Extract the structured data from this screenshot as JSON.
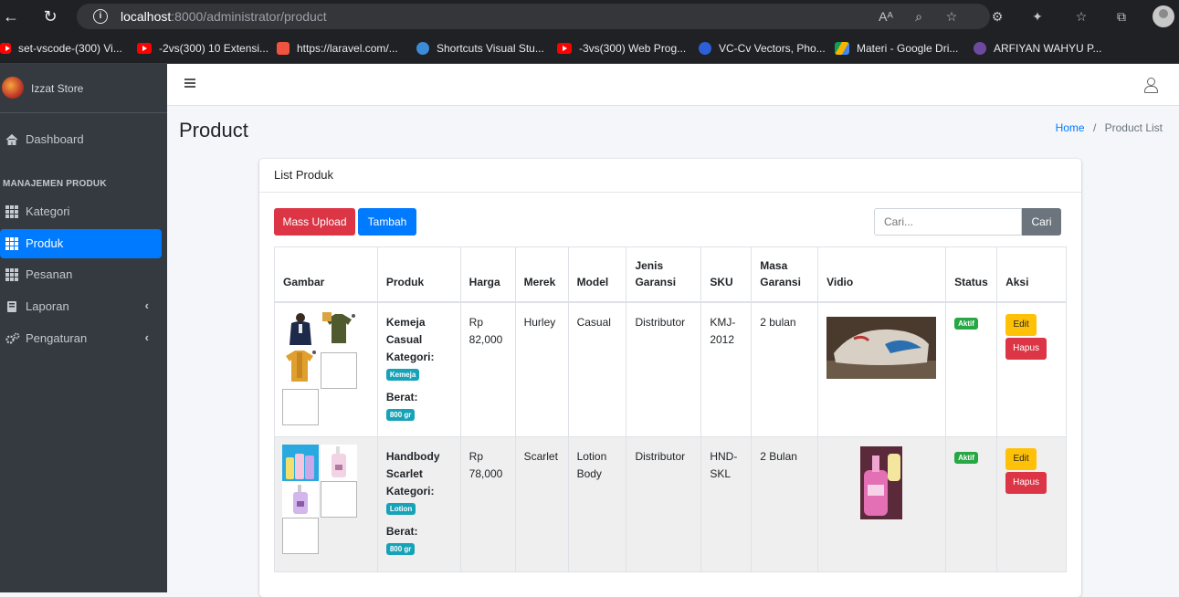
{
  "browser": {
    "url_host": "localhost",
    "url_rest": ":8000/administrator/product",
    "bookmarks": [
      {
        "label": "set-vscode-(300) Vi..."
      },
      {
        "label": "-2vs(300) 10 Extensi..."
      },
      {
        "label": "https://laravel.com/..."
      },
      {
        "label": "Shortcuts Visual Stu..."
      },
      {
        "label": "-3vs(300) Web Prog..."
      },
      {
        "label": "VC-Cv Vectors, Pho..."
      },
      {
        "label": "Materi - Google Dri..."
      },
      {
        "label": "ARFIYAN WAHYU P..."
      }
    ]
  },
  "sidebar": {
    "brand": "Izzat Store",
    "dashboard": "Dashboard",
    "header": "MANAJEMEN PRODUK",
    "items": [
      {
        "label": "Kategori"
      },
      {
        "label": "Produk"
      },
      {
        "label": "Pesanan"
      },
      {
        "label": "Laporan"
      },
      {
        "label": "Pengaturan"
      }
    ]
  },
  "page": {
    "title": "Product",
    "breadcrumb_home": "Home",
    "breadcrumb_current": "Product List"
  },
  "card": {
    "title": "List Produk",
    "mass_upload": "Mass Upload",
    "tambah": "Tambah",
    "search_placeholder": "Cari...",
    "search_button": "Cari"
  },
  "table": {
    "headers": [
      "Gambar",
      "Produk",
      "Harga",
      "Merek",
      "Model",
      "Jenis Garansi",
      "SKU",
      "Masa Garansi",
      "Vidio",
      "Status",
      "Aksi"
    ],
    "category_label": "Kategori:",
    "weight_label": "Berat:",
    "edit_label": "Edit",
    "delete_label": "Hapus",
    "rows": [
      {
        "name": "Kemeja Casual",
        "category": "Kemeja",
        "weight": "800 gr",
        "price": "Rp 82,000",
        "brand": "Hurley",
        "model": "Casual",
        "warranty_type": "Distributor",
        "sku": "KMJ-2012",
        "warranty_period": "2 bulan",
        "status": "Aktif"
      },
      {
        "name": "Handbody Scarlet",
        "category": "Lotion",
        "weight": "800 gr",
        "price": "Rp 78,000",
        "brand": "Scarlet",
        "model": "Lotion Body",
        "warranty_type": "Distributor",
        "sku": "HND-SKL",
        "warranty_period": "2 Bulan",
        "status": "Aktif"
      }
    ]
  }
}
